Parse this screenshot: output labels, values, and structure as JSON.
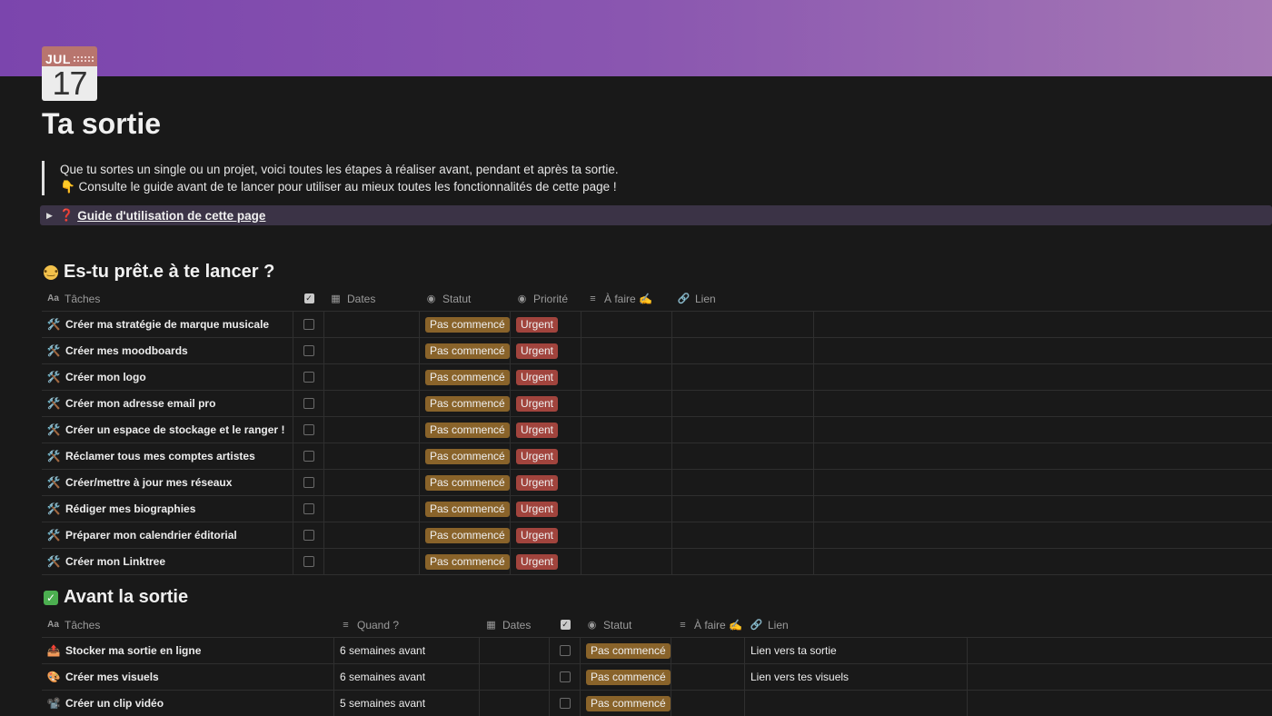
{
  "cover": {
    "colors": [
      "#7b45ad",
      "#a679b5"
    ]
  },
  "page_icon": {
    "month": "JUL",
    "day": "17",
    "icon": "calendar-icon"
  },
  "title": "Ta sortie",
  "callout": {
    "line1": "Que tu sortes un single ou un projet, voici toutes les étapes à réaliser avant, pendant et après ta sortie.",
    "line2": "👇 Consulte le guide avant de te lancer pour utiliser au mieux toutes les fonctionnalités de cette page !"
  },
  "toggle": {
    "label": "Guide d'utilisation de cette page",
    "icon": "❓"
  },
  "section1": {
    "emoji": "🤔",
    "heading": "Es-tu prêt.e à te lancer ?",
    "columns": {
      "title": "Tâches",
      "dates": "Dates",
      "status": "Statut",
      "priority": "Priorité",
      "todo": "À faire ✍️",
      "link": "Lien"
    },
    "rows": [
      {
        "emoji": "🛠️",
        "title": "Créer ma stratégie de marque musicale",
        "status": "Pas commencé",
        "priority": "Urgent"
      },
      {
        "emoji": "🛠️",
        "title": "Créer mes moodboards",
        "status": "Pas commencé",
        "priority": "Urgent"
      },
      {
        "emoji": "🛠️",
        "title": "Créer mon logo",
        "status": "Pas commencé",
        "priority": "Urgent"
      },
      {
        "emoji": "🛠️",
        "title": "Créer mon adresse email pro",
        "status": "Pas commencé",
        "priority": "Urgent"
      },
      {
        "emoji": "🛠️",
        "title": "Créer un espace de stockage et le ranger !",
        "status": "Pas commencé",
        "priority": "Urgent"
      },
      {
        "emoji": "🛠️",
        "title": "Réclamer tous mes comptes artistes",
        "status": "Pas commencé",
        "priority": "Urgent"
      },
      {
        "emoji": "🛠️",
        "title": "Créer/mettre à jour mes réseaux",
        "status": "Pas commencé",
        "priority": "Urgent"
      },
      {
        "emoji": "🛠️",
        "title": "Rédiger mes biographies",
        "status": "Pas commencé",
        "priority": "Urgent"
      },
      {
        "emoji": "🛠️",
        "title": "Préparer mon calendrier éditorial",
        "status": "Pas commencé",
        "priority": "Urgent"
      },
      {
        "emoji": "🛠️",
        "title": "Créer mon Linktree",
        "status": "Pas commencé",
        "priority": "Urgent"
      }
    ]
  },
  "section2": {
    "emoji": "✅",
    "heading": "Avant la sortie",
    "columns": {
      "title": "Tâches",
      "when": "Quand ?",
      "dates": "Dates",
      "status": "Statut",
      "todo": "À faire ✍️",
      "link": "Lien"
    },
    "rows": [
      {
        "emoji": "📤",
        "title": "Stocker ma sortie en ligne",
        "when": "6 semaines avant",
        "status": "Pas commencé",
        "link": "Lien vers ta sortie"
      },
      {
        "emoji": "🎨",
        "title": "Créer mes visuels",
        "when": "6 semaines avant",
        "status": "Pas commencé",
        "link": "Lien vers tes visuels"
      },
      {
        "emoji": "📽️",
        "title": "Créer un clip vidéo",
        "when": "5 semaines avant",
        "status": "Pas commencé",
        "link": ""
      }
    ]
  },
  "colors": {
    "status_tag": "#89632a",
    "urgent_tag": "#a1443d",
    "background": "#191919"
  }
}
